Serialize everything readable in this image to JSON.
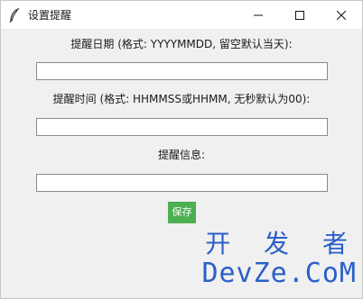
{
  "window": {
    "title": "设置提醒"
  },
  "form": {
    "date_label": "提醒日期 (格式: YYYYMMDD, 留空默认当天):",
    "date_value": "",
    "time_label": "提醒时间 (格式: HHMMSS或HHMM, 无秒默认为00):",
    "time_value": "",
    "message_label": "提醒信息:",
    "message_value": "",
    "save_label": "保存"
  },
  "watermark": {
    "line1": "开 发 者",
    "line2": "DevZe.CoM"
  },
  "colors": {
    "save_button": "#4caf50",
    "watermark": "#2a5fc8"
  }
}
